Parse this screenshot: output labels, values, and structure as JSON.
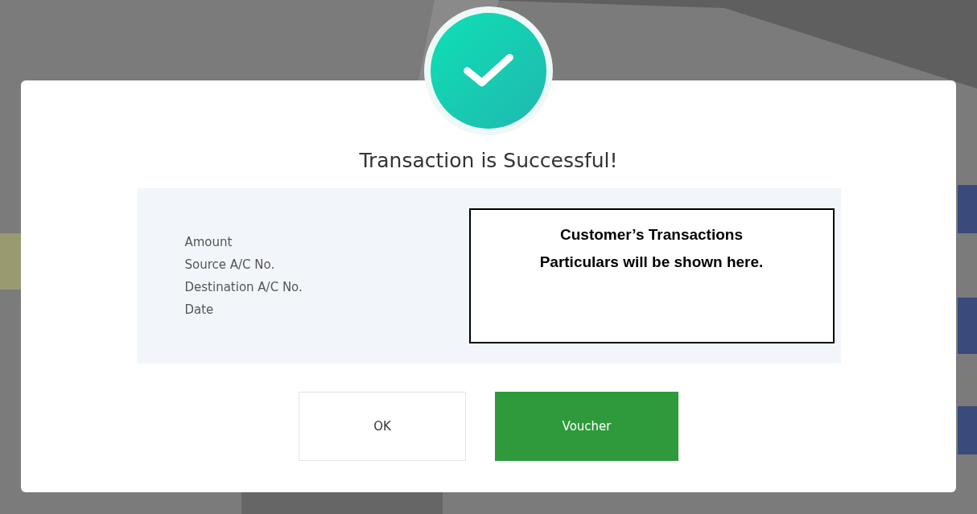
{
  "dialog": {
    "title": "Transaction is Successful!",
    "fields": [
      {
        "label": "Amount"
      },
      {
        "label": "Source A/C No."
      },
      {
        "label": "Destination A/C No."
      },
      {
        "label": "Date"
      }
    ],
    "note": {
      "lines": [
        "Customer’s Transactions",
        "Particulars will be shown here."
      ]
    },
    "buttons": [
      {
        "label": "OK",
        "kind": "secondary"
      },
      {
        "label": "Voucher",
        "kind": "primary"
      }
    ]
  }
}
